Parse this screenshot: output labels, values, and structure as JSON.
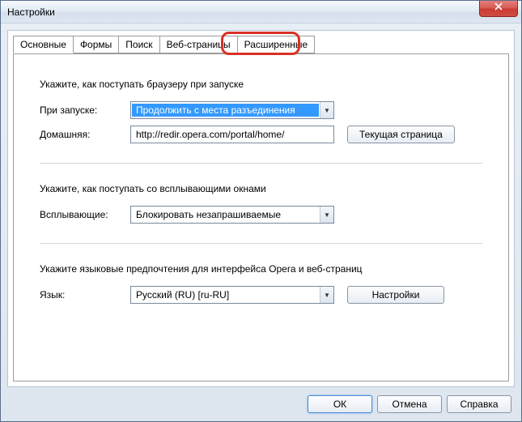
{
  "window": {
    "title": "Настройки"
  },
  "controls": {
    "close": "X"
  },
  "tabs": {
    "t0": "Основные",
    "t1": "Формы",
    "t2": "Поиск",
    "t3": "Веб-страницы",
    "t4": "Расширенные"
  },
  "startup": {
    "heading": "Укажите, как поступать браузеру при запуске",
    "label_on_start": "При запуске:",
    "on_start_value": "Продолжить с места разъединения",
    "label_home": "Домашняя:",
    "home_value": "http://redir.opera.com/portal/home/",
    "btn_current": "Текущая страница"
  },
  "popups": {
    "heading": "Укажите, как поступать со всплывающими окнами",
    "label": "Всплывающие:",
    "value": "Блокировать незапрашиваемые"
  },
  "language": {
    "heading": "Укажите языковые предпочтения для интерфейса Opera и веб-страниц",
    "label": "Язык:",
    "value": "Русский (RU) [ru-RU]",
    "btn_settings": "Настройки"
  },
  "footer": {
    "ok": "ОК",
    "cancel": "Отмена",
    "help": "Справка"
  }
}
